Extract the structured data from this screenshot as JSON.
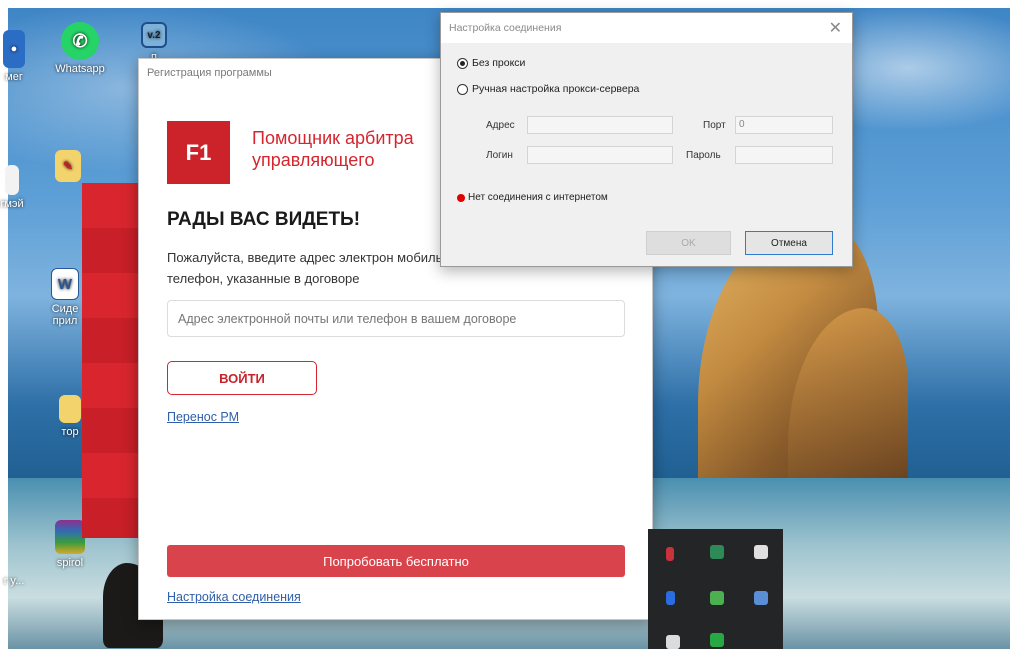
{
  "desktop": {
    "icons": [
      {
        "label": "Whatsapp",
        "icon": "whatsapp-icon"
      },
      {
        "label": "",
        "icon": "partial-icon"
      },
      {
        "label": "",
        "icon": "pdf-file-icon"
      },
      {
        "label": "",
        "icon": "word-doc-icon"
      },
      {
        "label": "",
        "icon": "folder-icon"
      },
      {
        "label": "",
        "icon": "winrar-icon"
      }
    ],
    "partial_labels": [
      "мег",
      "п",
      "гмэй",
      "Сиде прил",
      "тор",
      "spirol",
      "r",
      "r y..."
    ]
  },
  "registration_window": {
    "title": "Регистрация программы",
    "logo_text": "F1",
    "app_name": "Помощник арбитра управляющего",
    "greeting": "РАДЫ ВАС ВИДЕТЬ!",
    "instruction": "Пожалуйста, введите адрес электрон мобильный телефон, указанные в договоре",
    "login_placeholder": "Адрес электронной почты или телефон в вашем договоре",
    "login_button": "ВОЙТИ",
    "transfer_link": "Перенос РМ",
    "try_free_button": "Попробовать бесплатно",
    "connection_link": "Настройка соединения",
    "accent_color": "#d4262e"
  },
  "connection_dialog": {
    "title": "Настройка соединения",
    "options": [
      {
        "label": "Без прокси",
        "checked": true
      },
      {
        "label": "Ручная настройка прокси-сервера",
        "checked": false
      }
    ],
    "fields": {
      "address_label": "Адрес",
      "address_value": "",
      "port_label": "Порт",
      "port_value": "0",
      "login_label": "Логин",
      "login_value": "",
      "password_label": "Пароль",
      "password_value": ""
    },
    "status": "Нет соединения с интернетом",
    "status_color": "#e00000",
    "ok_button": "OK",
    "cancel_button": "Отмена"
  }
}
